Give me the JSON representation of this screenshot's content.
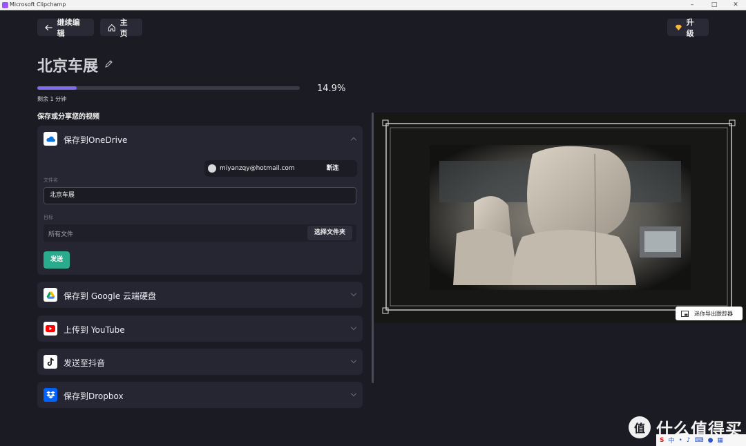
{
  "window": {
    "title": "Microsoft Clipchamp"
  },
  "topbar": {
    "back_label": "继续编辑",
    "home_label": "主页",
    "upgrade_label": "升级"
  },
  "project": {
    "title": "北京车展"
  },
  "export": {
    "progress": 0.149,
    "progress_text": "14.9%",
    "remaining_text": "剩余 1 分钟"
  },
  "share": {
    "section_title": "保存或分享您的视频",
    "onedrive": {
      "label": "保存到OneDrive",
      "account_email": "miyanzqy@hotmail.com",
      "disconnect_label": "断连",
      "filename_label": "文件名",
      "filename_value": "北京车展",
      "destination_label": "目标",
      "destination_value": "所有文件",
      "choose_folder_label": "选择文件夹",
      "send_label": "发送"
    },
    "services": [
      {
        "label": "保存到 Google 云端硬盘",
        "icon": "google-drive-icon"
      },
      {
        "label": "上传到 YouTube",
        "icon": "youtube-icon"
      },
      {
        "label": "发送至抖音",
        "icon": "tiktok-icon"
      },
      {
        "label": "保存到Dropbox",
        "icon": "dropbox-icon"
      }
    ]
  },
  "preview": {
    "mini_tracker_label": "迷你导出跟踪器"
  },
  "watermark": {
    "logo_char": "值",
    "text": "什么值得买"
  },
  "ime": {
    "mode_char": "中"
  },
  "colors": {
    "background": "#1b1b23",
    "card": "#262633",
    "accent_purple": "#7e6cf0",
    "send_green": "#2bab8e"
  }
}
